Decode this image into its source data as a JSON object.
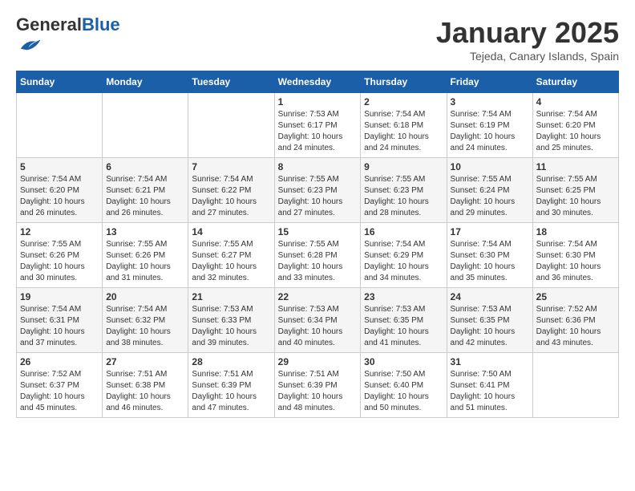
{
  "header": {
    "logo_general": "General",
    "logo_blue": "Blue",
    "month": "January 2025",
    "location": "Tejeda, Canary Islands, Spain"
  },
  "weekdays": [
    "Sunday",
    "Monday",
    "Tuesday",
    "Wednesday",
    "Thursday",
    "Friday",
    "Saturday"
  ],
  "weeks": [
    [
      {
        "day": "",
        "info": ""
      },
      {
        "day": "",
        "info": ""
      },
      {
        "day": "",
        "info": ""
      },
      {
        "day": "1",
        "info": "Sunrise: 7:53 AM\nSunset: 6:17 PM\nDaylight: 10 hours\nand 24 minutes."
      },
      {
        "day": "2",
        "info": "Sunrise: 7:54 AM\nSunset: 6:18 PM\nDaylight: 10 hours\nand 24 minutes."
      },
      {
        "day": "3",
        "info": "Sunrise: 7:54 AM\nSunset: 6:19 PM\nDaylight: 10 hours\nand 24 minutes."
      },
      {
        "day": "4",
        "info": "Sunrise: 7:54 AM\nSunset: 6:20 PM\nDaylight: 10 hours\nand 25 minutes."
      }
    ],
    [
      {
        "day": "5",
        "info": "Sunrise: 7:54 AM\nSunset: 6:20 PM\nDaylight: 10 hours\nand 26 minutes."
      },
      {
        "day": "6",
        "info": "Sunrise: 7:54 AM\nSunset: 6:21 PM\nDaylight: 10 hours\nand 26 minutes."
      },
      {
        "day": "7",
        "info": "Sunrise: 7:54 AM\nSunset: 6:22 PM\nDaylight: 10 hours\nand 27 minutes."
      },
      {
        "day": "8",
        "info": "Sunrise: 7:55 AM\nSunset: 6:23 PM\nDaylight: 10 hours\nand 27 minutes."
      },
      {
        "day": "9",
        "info": "Sunrise: 7:55 AM\nSunset: 6:23 PM\nDaylight: 10 hours\nand 28 minutes."
      },
      {
        "day": "10",
        "info": "Sunrise: 7:55 AM\nSunset: 6:24 PM\nDaylight: 10 hours\nand 29 minutes."
      },
      {
        "day": "11",
        "info": "Sunrise: 7:55 AM\nSunset: 6:25 PM\nDaylight: 10 hours\nand 30 minutes."
      }
    ],
    [
      {
        "day": "12",
        "info": "Sunrise: 7:55 AM\nSunset: 6:26 PM\nDaylight: 10 hours\nand 30 minutes."
      },
      {
        "day": "13",
        "info": "Sunrise: 7:55 AM\nSunset: 6:26 PM\nDaylight: 10 hours\nand 31 minutes."
      },
      {
        "day": "14",
        "info": "Sunrise: 7:55 AM\nSunset: 6:27 PM\nDaylight: 10 hours\nand 32 minutes."
      },
      {
        "day": "15",
        "info": "Sunrise: 7:55 AM\nSunset: 6:28 PM\nDaylight: 10 hours\nand 33 minutes."
      },
      {
        "day": "16",
        "info": "Sunrise: 7:54 AM\nSunset: 6:29 PM\nDaylight: 10 hours\nand 34 minutes."
      },
      {
        "day": "17",
        "info": "Sunrise: 7:54 AM\nSunset: 6:30 PM\nDaylight: 10 hours\nand 35 minutes."
      },
      {
        "day": "18",
        "info": "Sunrise: 7:54 AM\nSunset: 6:30 PM\nDaylight: 10 hours\nand 36 minutes."
      }
    ],
    [
      {
        "day": "19",
        "info": "Sunrise: 7:54 AM\nSunset: 6:31 PM\nDaylight: 10 hours\nand 37 minutes."
      },
      {
        "day": "20",
        "info": "Sunrise: 7:54 AM\nSunset: 6:32 PM\nDaylight: 10 hours\nand 38 minutes."
      },
      {
        "day": "21",
        "info": "Sunrise: 7:53 AM\nSunset: 6:33 PM\nDaylight: 10 hours\nand 39 minutes."
      },
      {
        "day": "22",
        "info": "Sunrise: 7:53 AM\nSunset: 6:34 PM\nDaylight: 10 hours\nand 40 minutes."
      },
      {
        "day": "23",
        "info": "Sunrise: 7:53 AM\nSunset: 6:35 PM\nDaylight: 10 hours\nand 41 minutes."
      },
      {
        "day": "24",
        "info": "Sunrise: 7:53 AM\nSunset: 6:35 PM\nDaylight: 10 hours\nand 42 minutes."
      },
      {
        "day": "25",
        "info": "Sunrise: 7:52 AM\nSunset: 6:36 PM\nDaylight: 10 hours\nand 43 minutes."
      }
    ],
    [
      {
        "day": "26",
        "info": "Sunrise: 7:52 AM\nSunset: 6:37 PM\nDaylight: 10 hours\nand 45 minutes."
      },
      {
        "day": "27",
        "info": "Sunrise: 7:51 AM\nSunset: 6:38 PM\nDaylight: 10 hours\nand 46 minutes."
      },
      {
        "day": "28",
        "info": "Sunrise: 7:51 AM\nSunset: 6:39 PM\nDaylight: 10 hours\nand 47 minutes."
      },
      {
        "day": "29",
        "info": "Sunrise: 7:51 AM\nSunset: 6:39 PM\nDaylight: 10 hours\nand 48 minutes."
      },
      {
        "day": "30",
        "info": "Sunrise: 7:50 AM\nSunset: 6:40 PM\nDaylight: 10 hours\nand 50 minutes."
      },
      {
        "day": "31",
        "info": "Sunrise: 7:50 AM\nSunset: 6:41 PM\nDaylight: 10 hours\nand 51 minutes."
      },
      {
        "day": "",
        "info": ""
      }
    ]
  ]
}
